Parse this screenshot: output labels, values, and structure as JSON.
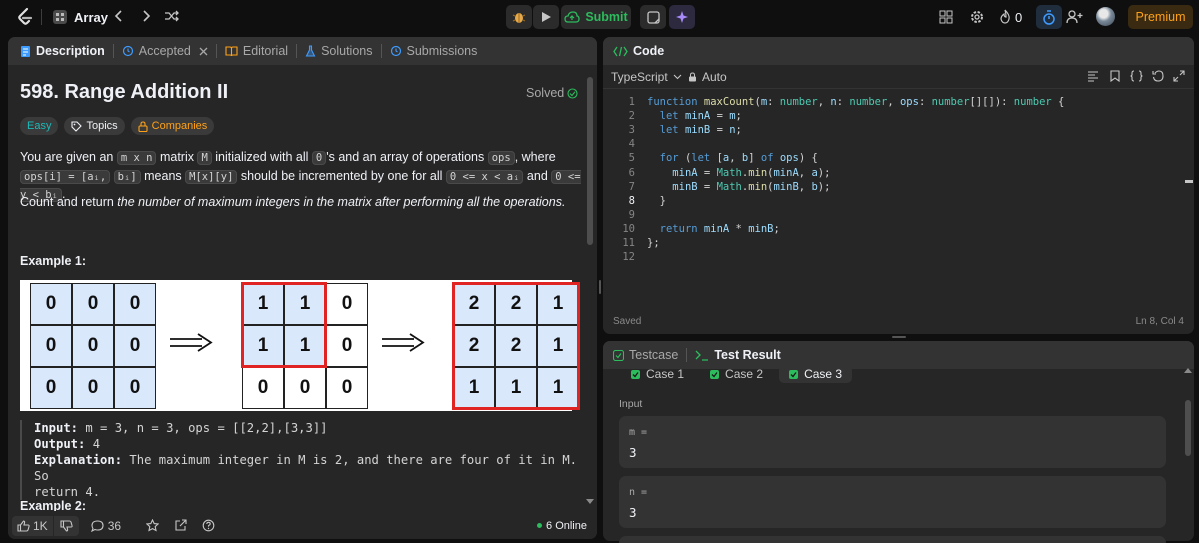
{
  "topbar": {
    "problem_list_title": "Array",
    "submit_label": "Submit",
    "streak_count": "0",
    "premium_label": "Premium"
  },
  "left": {
    "tabs": [
      "Description",
      "Accepted",
      "Editorial",
      "Solutions",
      "Submissions"
    ],
    "title": "598. Range Addition II",
    "solved_label": "Solved",
    "tags": [
      "Easy",
      "Topics",
      "Companies"
    ],
    "para1": {
      "t1": "You are given an",
      "c1": "m x n",
      "t2": "matrix",
      "c2": "M",
      "t3": "initialized with all",
      "c3": "0",
      "t4": "'s and an array of operations",
      "c4": "ops",
      "t5": ", where",
      "c5": "ops[i] = [aᵢ,",
      "c6": "bᵢ]",
      "t6": "means",
      "c7": "M[x][y]",
      "t7": "should be incremented by one for all",
      "c8": "0 <= x < aᵢ",
      "t8": "and",
      "c9": "0 <= y < bᵢ",
      "t9": "."
    },
    "para2_plain": "Count and return ",
    "para2_italic": "the number of maximum integers in the matrix after performing all the operations.",
    "example1_title": "Example 1:",
    "matrices": [
      [
        "0",
        "0",
        "0",
        "0",
        "0",
        "0",
        "0",
        "0",
        "0"
      ],
      [
        "1",
        "1",
        "0",
        "1",
        "1",
        "0",
        "0",
        "0",
        "0"
      ],
      [
        "2",
        "2",
        "1",
        "2",
        "2",
        "1",
        "1",
        "1",
        "1"
      ]
    ],
    "example": {
      "input_label": "Input:",
      "input_value": "m = 3, n = 3, ops = [[2,2],[3,3]]",
      "output_label": "Output:",
      "output_value": "4",
      "explanation_label": "Explanation:",
      "explanation_value": "The maximum integer in M is 2, and there are four of it in M. So",
      "explanation_value2": "return 4."
    },
    "example2_title": "Example 2:",
    "footer": {
      "likes": "1K",
      "comments": "36",
      "online": "6 Online"
    }
  },
  "code": {
    "title": "Code",
    "language": "TypeScript",
    "mode": "Auto",
    "saved": "Saved",
    "cursor": "Ln 8, Col 4",
    "lines": [
      "function maxCount(m: number, n: number, ops: number[][]): number {",
      "  let minA = m;",
      "  let minB = n;",
      "",
      "  for (let [a, b] of ops) {",
      "    minA = Math.min(minA, a);",
      "    minB = Math.min(minB, b);",
      "  }",
      "",
      "  return minA * minB;",
      "};",
      ""
    ]
  },
  "test": {
    "tabs": [
      "Testcase",
      "Test Result"
    ],
    "cases": [
      "Case 1",
      "Case 2",
      "Case 3"
    ],
    "input_label": "Input",
    "params": [
      {
        "name": "m =",
        "value": "3"
      },
      {
        "name": "n =",
        "value": "3"
      }
    ]
  },
  "colors": {
    "accent_green": "#2cbb5d",
    "easy_teal": "#1cbaba",
    "premium_orange": "#ffa116",
    "highlight_red": "#e02424",
    "cell_blue": "#dae8fc"
  }
}
